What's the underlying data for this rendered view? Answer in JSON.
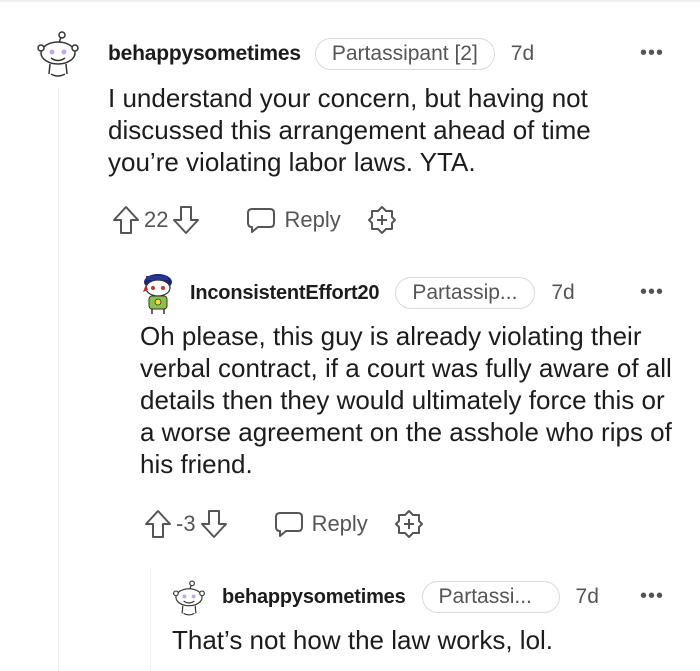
{
  "comments": [
    {
      "username": "behappysometimes",
      "flair": "Partassipant [2]",
      "time": "7d",
      "more": "•••",
      "body": "I understand your concern, but having not discussed this arrangement ahead of time you’re violating labor laws. YTA.",
      "score": "22",
      "reply_label": "Reply"
    },
    {
      "username": "InconsistentEffort20",
      "flair": "Partassip...",
      "time": "7d",
      "more": "•••",
      "body": "Oh please, this guy is already violating their verbal contract, if a court was fully aware of all details then they would ultimately force this or a worse agreement on the asshole who rips of his friend.",
      "score": "-3",
      "reply_label": "Reply"
    },
    {
      "username": "behappysometimes",
      "flair": "Partassi...",
      "time": "7d",
      "more": "•••",
      "body": "That’s not how the law works, lol."
    }
  ],
  "icons": {
    "upvote": "arrow-up-icon",
    "downvote": "arrow-down-icon",
    "reply": "speech-bubble-icon",
    "award": "award-plus-icon",
    "more": "more-horizontal-icon"
  }
}
